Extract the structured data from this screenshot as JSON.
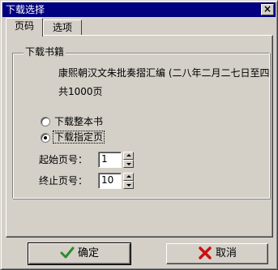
{
  "window": {
    "title": "下载选择",
    "close_glyph": "×"
  },
  "tabs": [
    {
      "label": "页码",
      "active": true
    },
    {
      "label": "选项",
      "active": false
    }
  ],
  "group": {
    "legend": "下载书籍",
    "book_title": "康熙朝汉文朱批奏摺汇编 (二八年二月二七日至四",
    "page_count": "共1000页"
  },
  "download_mode": {
    "options": [
      {
        "label": "下载整本书",
        "selected": false
      },
      {
        "label": "下载指定页",
        "selected": true
      }
    ]
  },
  "page_range": {
    "start_label": "起始页号：",
    "start_value": "1",
    "end_label": "终止页号：",
    "end_value": "10"
  },
  "buttons": {
    "ok_label": "确定",
    "cancel_label": "取消",
    "ok_icon": "checkmark-icon",
    "cancel_icon": "red-x-icon"
  },
  "colors": {
    "titlebar": "#000080",
    "face": "#d4d0c8",
    "ok_icon": "#2e8b2e",
    "cancel_icon": "#cc1010"
  }
}
